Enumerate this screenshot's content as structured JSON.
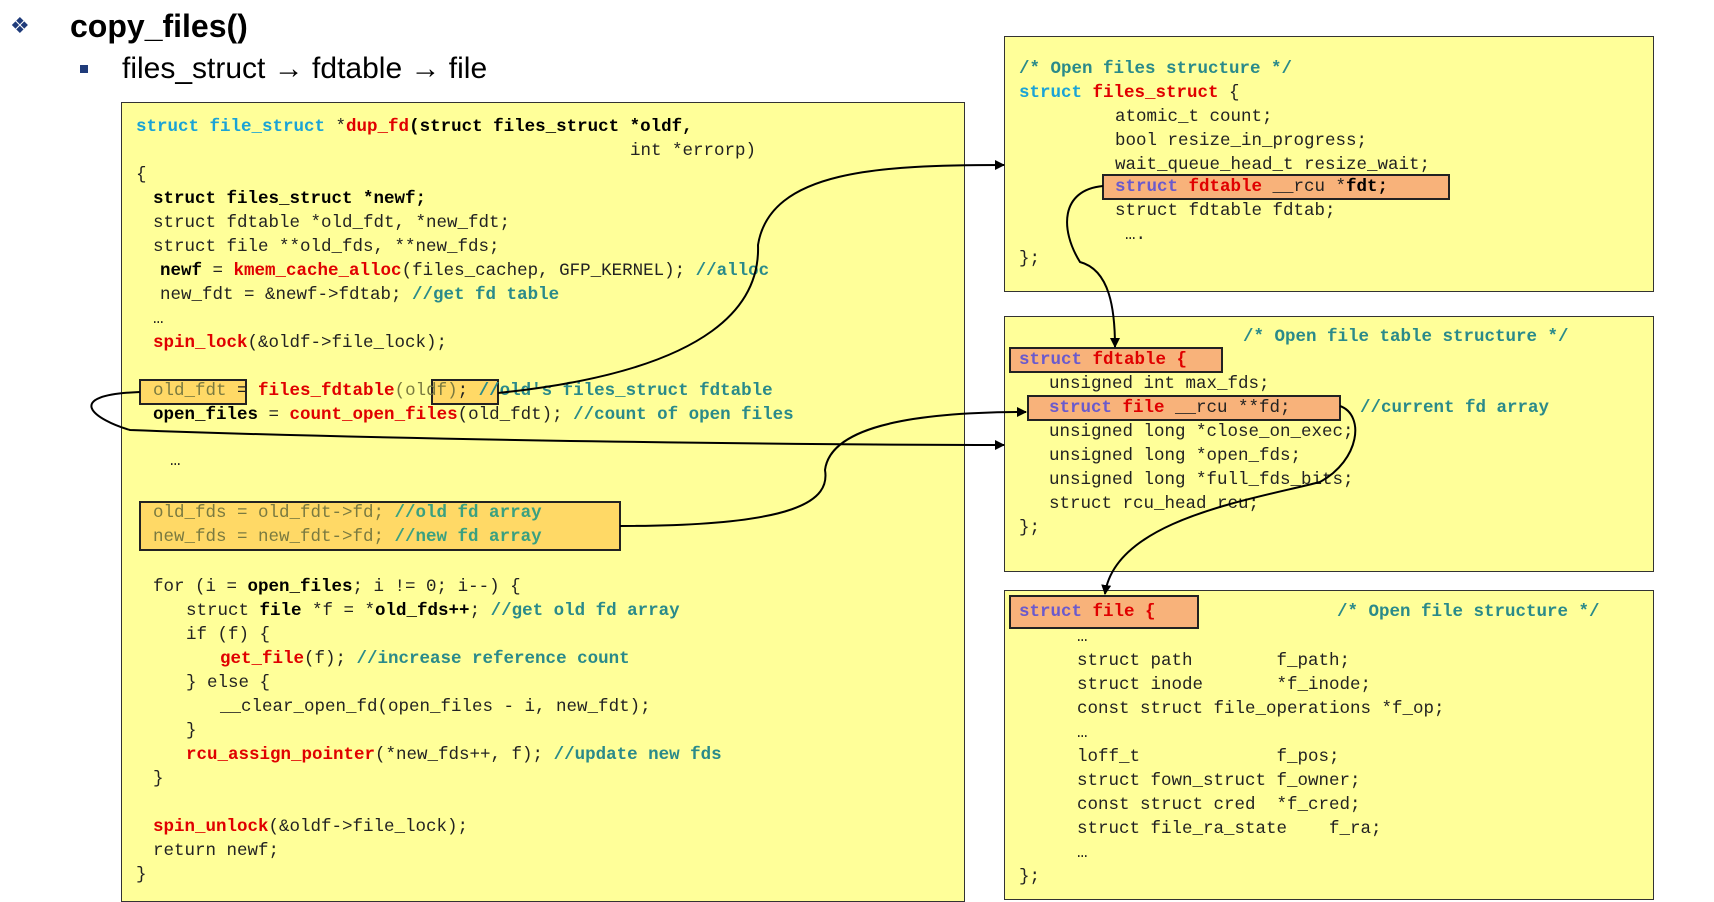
{
  "header": {
    "title": "copy_files()",
    "subtitle": "files_struct → fdtable → file"
  },
  "left_code": {
    "l1a": "struct file_struct",
    "l1b": " *",
    "l1c": "dup_fd",
    "l1d": "(struct files_struct *oldf,",
    "l2": "int *errorp)",
    "l3": "{",
    "l4": "struct files_struct *newf;",
    "l5": "struct fdtable *old_fdt, *new_fdt;",
    "l6": "struct file **old_fds, **new_fds;",
    "l7a": "newf",
    "l7b": " = ",
    "l7c": "kmem_cache_alloc",
    "l7d": "(files_cachep, GFP_KERNEL); ",
    "l7e": "//alloc",
    "l8a": "new_fdt = &newf->fdtab; ",
    "l8b": "//get fd table",
    "l9": "…",
    "l10a": "spin_lock",
    "l10b": "(&oldf->file_lock);",
    "l11a": "old_fdt",
    "l11b": " = ",
    "l11c": "files_fdtable",
    "l11d": "(oldf)",
    "l11e": "; ",
    "l11f": "//old's files_struct fdtable",
    "l12a": "open_files",
    "l12b": " = ",
    "l12c": "count_open_files",
    "l12d": "(old_fdt); ",
    "l12e": "//count of open files",
    "l13": "…",
    "l14a": "old_fds = old_fdt->fd; ",
    "l14b": "//old fd array",
    "l15a": "new_fds = new_fdt->fd; ",
    "l15b": "//new fd array",
    "l16a": "for (i = ",
    "l16b": "open_files",
    "l16c": "; i != 0; i--) {",
    "l17a": "struct ",
    "l17b": "file",
    "l17c": " *f = *",
    "l17d": "old_fds++",
    "l17e": "; ",
    "l17f": "//get old fd array",
    "l18": "if (f) {",
    "l19a": "get_file",
    "l19b": "(f); ",
    "l19c": "//increase reference count",
    "l20": "} else {",
    "l21": "__clear_open_fd(open_files - i, new_fdt);",
    "l22": "}",
    "l23a": "rcu_assign_pointer",
    "l23b": "(*new_fds++, f); ",
    "l23c": "//update new fds",
    "l24": "}",
    "l25a": "spin_unlock",
    "l25b": "(&oldf->file_lock);",
    "l26": "return newf;",
    "l27": "}"
  },
  "box1": {
    "comment": "/* Open files structure */",
    "l1a": "struct ",
    "l1b": "files_struct",
    "l1c": " {",
    "l2": "atomic_t count;",
    "l3": "bool resize_in_progress;",
    "l4": "wait_queue_head_t resize_wait;",
    "l5a": "struct ",
    "l5b": "fdtable",
    "l5c": " __rcu *",
    "l5d": "fdt;",
    "l6": "struct fdtable fdtab;",
    "l7": "….",
    "l8": "};"
  },
  "box2": {
    "comment": "/* Open file table structure */",
    "l1a": "struct ",
    "l1b": "fdtable",
    "l1c": " {",
    "l2": "unsigned int max_fds;",
    "l3a": "struct ",
    "l3b": "file",
    "l3c": " __rcu **fd;",
    "l3d": "//current fd array",
    "l4": "unsigned long *close_on_exec;",
    "l5": "unsigned long *open_fds;",
    "l6": "unsigned long *full_fds_bits;",
    "l7": "struct rcu_head rcu;",
    "l8": "};"
  },
  "box3": {
    "l1a": "struct ",
    "l1b": "file",
    "l1c": " {",
    "comment": "/* Open file structure */",
    "l2": "…",
    "l3": "struct path        f_path;",
    "l4": "struct inode       *f_inode;",
    "l5": "const struct file_operations *f_op;",
    "l6": "…",
    "l7": "loff_t             f_pos;",
    "l8": "struct fown_struct f_owner;",
    "l9": "const struct cred  *f_cred;",
    "l10": "struct file_ra_state    f_ra;",
    "l11": "…",
    "l12": "};"
  },
  "colors": {
    "box_bg": "#ffff99",
    "highlight_yellow": "#ffd966",
    "highlight_orange": "#f8b27a",
    "keyword": "#1aa3d6",
    "function": "#e00000",
    "comment": "#2a8a8a"
  },
  "icons": {
    "title_bullet": "diamond-bullet-icon",
    "sub_bullet": "square-bullet-icon"
  }
}
